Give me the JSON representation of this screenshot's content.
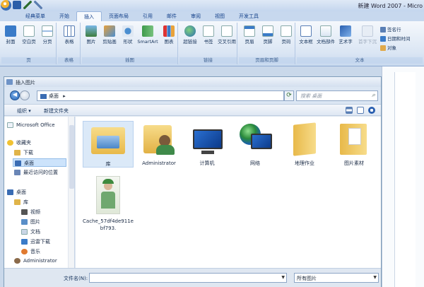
{
  "window": {
    "title": "新建 Word 2007 - Micro"
  },
  "ribbon": {
    "tabs": [
      "经典菜单",
      "开始",
      "插入",
      "页面布局",
      "引用",
      "邮件",
      "审阅",
      "视图",
      "开发工具"
    ],
    "active_tab": "插入",
    "groups": {
      "pages": {
        "label": "页",
        "buttons": [
          "封面",
          "空白页",
          "分页"
        ]
      },
      "tables": {
        "label": "表格",
        "buttons": [
          "表格"
        ]
      },
      "illustrations": {
        "label": "插图",
        "buttons": [
          "图片",
          "剪贴画",
          "形状",
          "SmartArt",
          "图表"
        ]
      },
      "links": {
        "label": "链接",
        "buttons": [
          "超链接",
          "书签",
          "交叉引用"
        ]
      },
      "header_footer": {
        "label": "页眉和页脚",
        "buttons": [
          "页眉",
          "页脚",
          "页码"
        ]
      },
      "text": {
        "label": "文本",
        "buttons": [
          "文本框",
          "文档部件",
          "艺术字",
          "首字下沉"
        ],
        "small": [
          "签名行",
          "日期和时间",
          "对象"
        ]
      }
    }
  },
  "dialog": {
    "title": "插入图片",
    "address": "桌面",
    "address_sep": "▸",
    "search_placeholder": "搜索 桌面",
    "toolbar": {
      "organize": "组织 ▾",
      "new_folder": "新建文件夹"
    },
    "nav": {
      "items": [
        {
          "label": "Microsoft Office",
          "icon": "office-icon"
        },
        {
          "label": "收藏夹",
          "icon": "star-icon"
        },
        {
          "label": "下载",
          "icon": "download-folder-icon"
        },
        {
          "label": "桌面",
          "icon": "desktop-icon",
          "selected": true
        },
        {
          "label": "最近访问的位置",
          "icon": "recent-places-icon"
        },
        {
          "label": "桌面",
          "icon": "desktop-icon"
        },
        {
          "label": "库",
          "icon": "library-icon"
        },
        {
          "label": "视频",
          "icon": "video-library-icon"
        },
        {
          "label": "图片",
          "icon": "pictures-library-icon"
        },
        {
          "label": "文档",
          "icon": "documents-library-icon"
        },
        {
          "label": "迅雷下载",
          "icon": "thunder-download-icon"
        },
        {
          "label": "音乐",
          "icon": "music-library-icon"
        },
        {
          "label": "Administrator",
          "icon": "user-icon"
        }
      ]
    },
    "files": [
      {
        "label": "库",
        "icon": "library-folder-icon"
      },
      {
        "label": "Administrator",
        "icon": "user-folder-icon"
      },
      {
        "label": "计算机",
        "icon": "computer-icon"
      },
      {
        "label": "网络",
        "icon": "network-icon"
      },
      {
        "label": "地理作业",
        "icon": "folder-icon"
      },
      {
        "label": "图片素材",
        "icon": "folder-icon"
      },
      {
        "label": "Cache_57df4de911ebf793.",
        "icon": "image-thumbnail-icon"
      }
    ],
    "filename": {
      "label": "文件名(N):",
      "value": ""
    },
    "filetype": {
      "value": "所有图片"
    }
  }
}
